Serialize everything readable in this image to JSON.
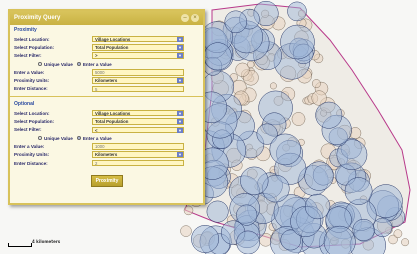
{
  "panel": {
    "title": "Proximity Query",
    "header_icons": [
      "minimize-icon",
      "close-icon"
    ]
  },
  "proximity": {
    "section_title": "Proximity",
    "select_location_label": "Select Location:",
    "select_location_value": "Village Locations",
    "select_population_label": "Select Population:",
    "select_population_value": "Total Population",
    "select_filter_label": "Select Filter:",
    "select_filter_value": ">",
    "unique_value_label": "Unique Value",
    "enter_value_option_label": "Enter a Value",
    "enter_value_label": "Enter a Value:",
    "enter_value_value": "5000",
    "units_label": "Proximity Units:",
    "units_value": "Kilometers",
    "distance_label": "Enter Distance:",
    "distance_value": "5"
  },
  "optional": {
    "section_title": "Optional",
    "select_location_label": "Select Location:",
    "select_location_value": "Village Locations",
    "select_population_label": "Select Population:",
    "select_population_value": "Total Population",
    "select_filter_label": "Select Filter:",
    "select_filter_value": "<",
    "unique_value_label": "Unique Value",
    "enter_value_option_label": "Enter a Value",
    "enter_value_label": "Enter a Value:",
    "enter_value_value": "1000",
    "units_label": "Proximity Units:",
    "units_value": "Kilometers",
    "distance_label": "Enter Distance:",
    "distance_value": "2"
  },
  "submit_label": "Proximity",
  "scalebar_label": "4 kilometers",
  "colors": {
    "panel_bg": "#fbf8e3",
    "panel_border": "#d8c25a",
    "blue_circle": "#9db6d8",
    "tan_circle": "#e8d3bf",
    "boundary": "#b8398a"
  }
}
